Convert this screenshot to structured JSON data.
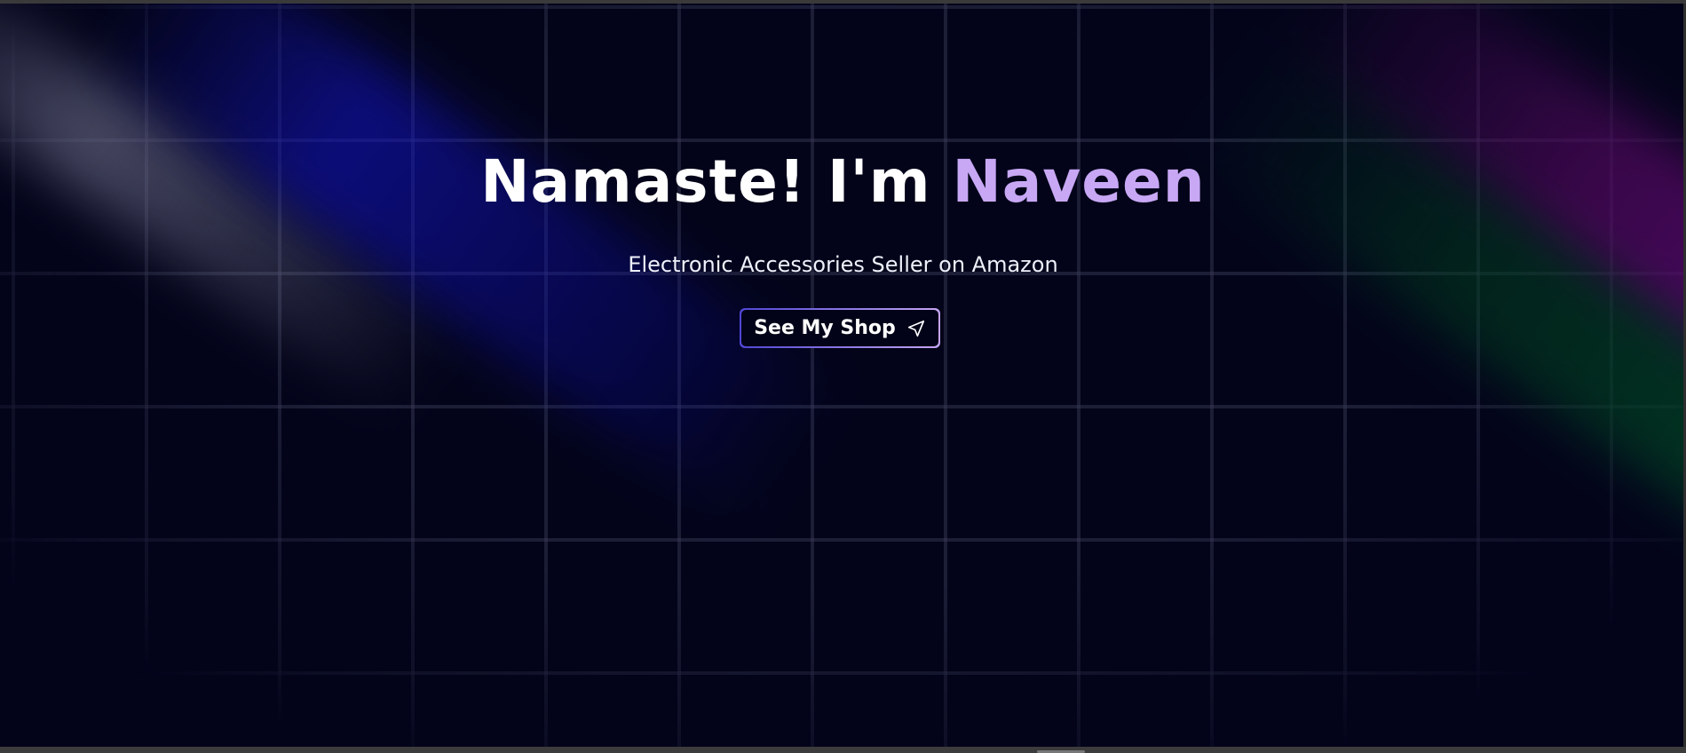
{
  "hero": {
    "title_prefix": "Namaste! I'm ",
    "title_name": "Naveen",
    "subtitle": "Electronic Accessories Seller on Amazon",
    "cta_label": "See My Shop",
    "cta_icon": "paper-plane-icon"
  },
  "colors": {
    "background": "#03041a",
    "accent": "#c8a8f5",
    "button_border_start": "#4f46d6",
    "button_border_end": "#c4a6f2"
  }
}
